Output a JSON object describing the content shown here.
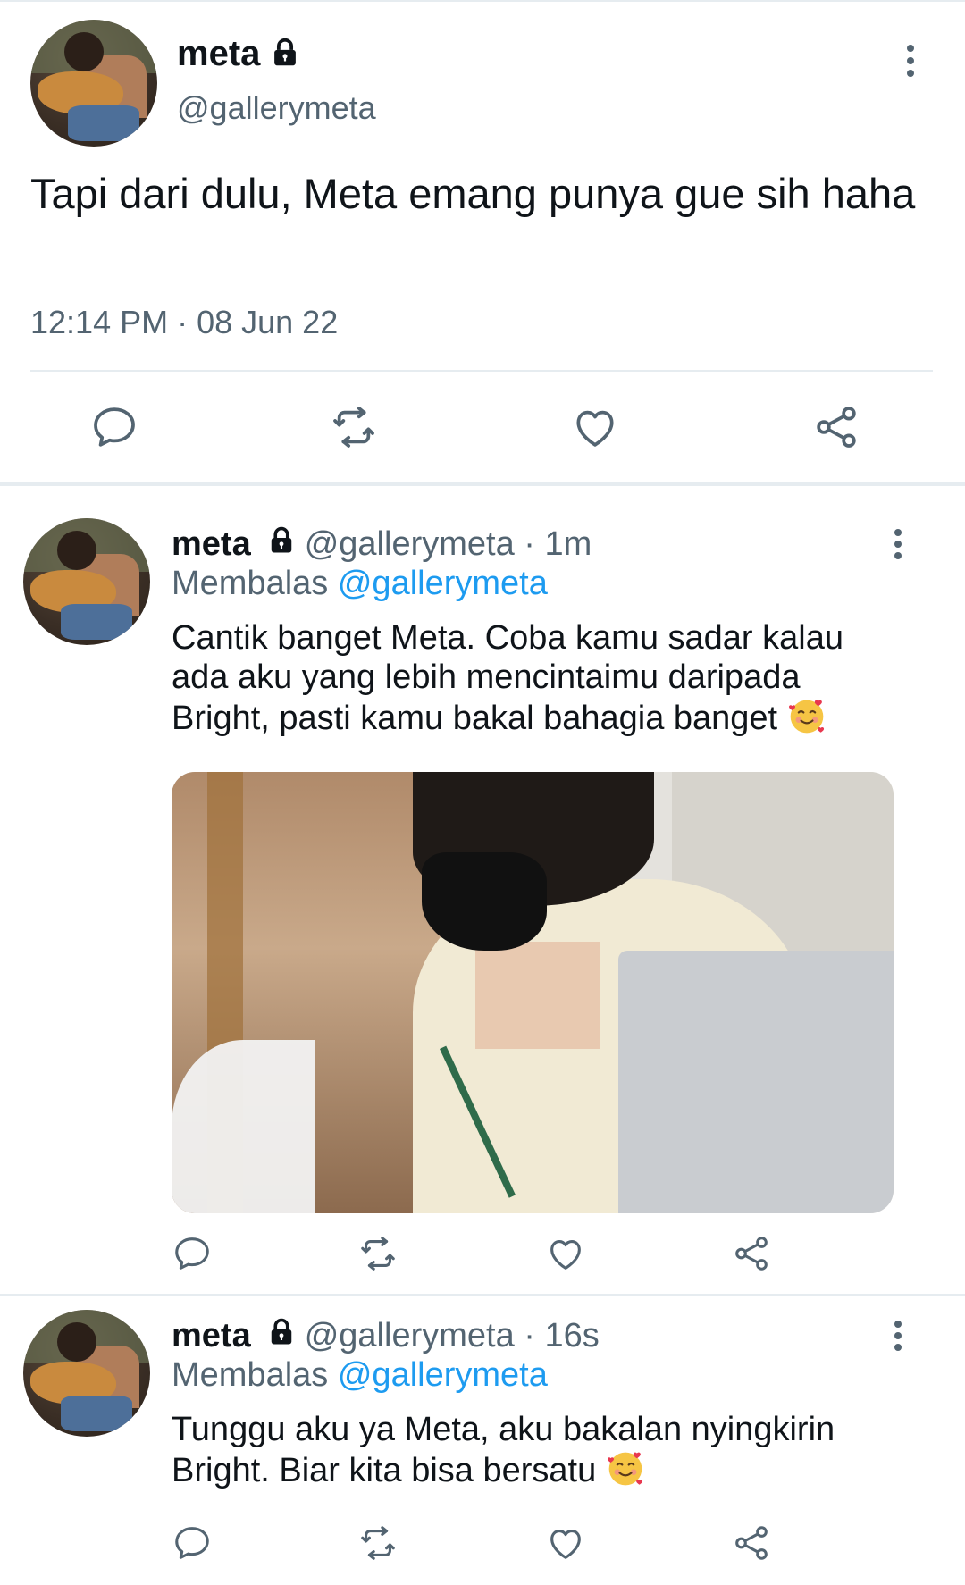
{
  "main_tweet": {
    "name": "meta",
    "handle": "@gallerymeta",
    "text": "Tapi dari dulu, Meta emang punya gue sih haha",
    "timestamp": "12:14 PM · 08 Jun 22"
  },
  "replies": [
    {
      "name": "meta",
      "handle_time": "@gallerymeta · 1m",
      "replying_prefix": "Membalas",
      "replying_to": "@gallerymeta",
      "text": "Cantik banget Meta. Coba kamu sadar kalau ada aku yang lebih mencintaimu daripada Bright, pasti kamu bakal bahagia banget",
      "emoji": "smiling-face-with-hearts",
      "has_media": true
    },
    {
      "name": "meta",
      "handle_time": "@gallerymeta · 16s",
      "replying_prefix": "Membalas",
      "replying_to": "@gallerymeta",
      "text": "Tunggu aku ya Meta, aku bakalan nyingkirin Bright. Biar kita bisa bersatu",
      "emoji": "smiling-face-with-hearts",
      "has_media": false
    }
  ],
  "icons": {
    "reply": "reply-icon",
    "retweet": "retweet-icon",
    "like": "like-icon",
    "share": "share-icon",
    "lock": "lock-icon",
    "more": "more-vertical-icon"
  },
  "colors": {
    "text": "#0f1419",
    "secondary": "#536471",
    "link": "#1d9bf0",
    "divider": "#e6ecf0"
  }
}
